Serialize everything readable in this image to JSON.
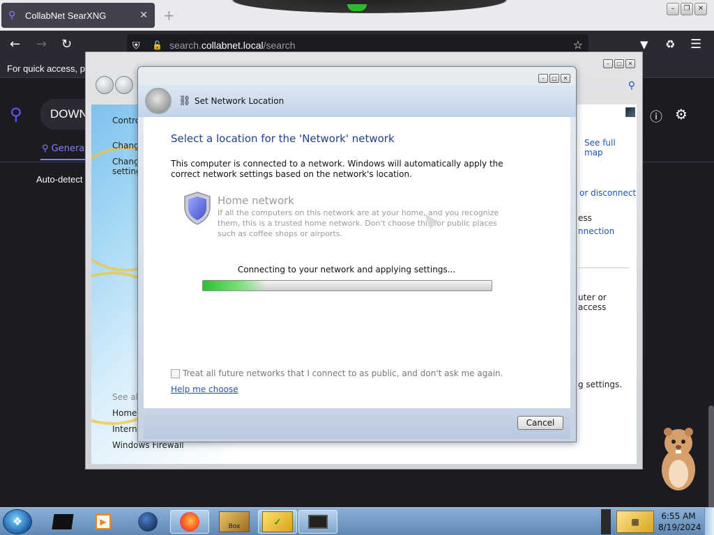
{
  "browser": {
    "tab_title": "CollabNet SearXNG",
    "tab_close": "✕",
    "new_tab": "+",
    "url_host": "search.collabnet.local",
    "url_path": "/search",
    "bookmarks_hint": "For quick access, plac"
  },
  "searx": {
    "query_value": "DOWN",
    "tab_general": "Genera",
    "autodetect": "Auto-detect"
  },
  "nsc": {
    "sidebar": {
      "items": [
        "Contro",
        "Change",
        "Change",
        "setting"
      ],
      "see_also": "See also",
      "links": [
        "HomeG",
        "Intern",
        "Windows Firewall"
      ]
    },
    "main": {
      "see_full_map": "See full map",
      "or_disconnect": "or disconnect",
      "access": "ess",
      "connection": "nnection",
      "router_access": "uter or access",
      "settings": "g settings."
    }
  },
  "dialog": {
    "title": "Set Network Location",
    "heading": "Select a location for the 'Network' network",
    "description": "This computer is connected to a network. Windows will automatically apply the correct network settings based on the network's location.",
    "option_title": "Home network",
    "option_desc": "If all the computers on this network are at your home, and you recognize them, this is a trusted home network.  Don't choose this for public places such as coffee shops or airports.",
    "progress_label": "Connecting to your network and applying settings...",
    "progress_fraction": 0.22,
    "checkbox_label": "Treat all future networks that I connect to as public, and don't ask me again.",
    "checkbox_checked": false,
    "help_link": "Help me choose",
    "cancel": "Cancel"
  },
  "taskbar": {
    "time": "6:55 AM",
    "date": "8/19/2024",
    "tray_label": "Box"
  },
  "colors": {
    "accent": "#7f83ff",
    "dialog_heading": "#1e3f8a",
    "progress_green": "#2fbf30"
  }
}
